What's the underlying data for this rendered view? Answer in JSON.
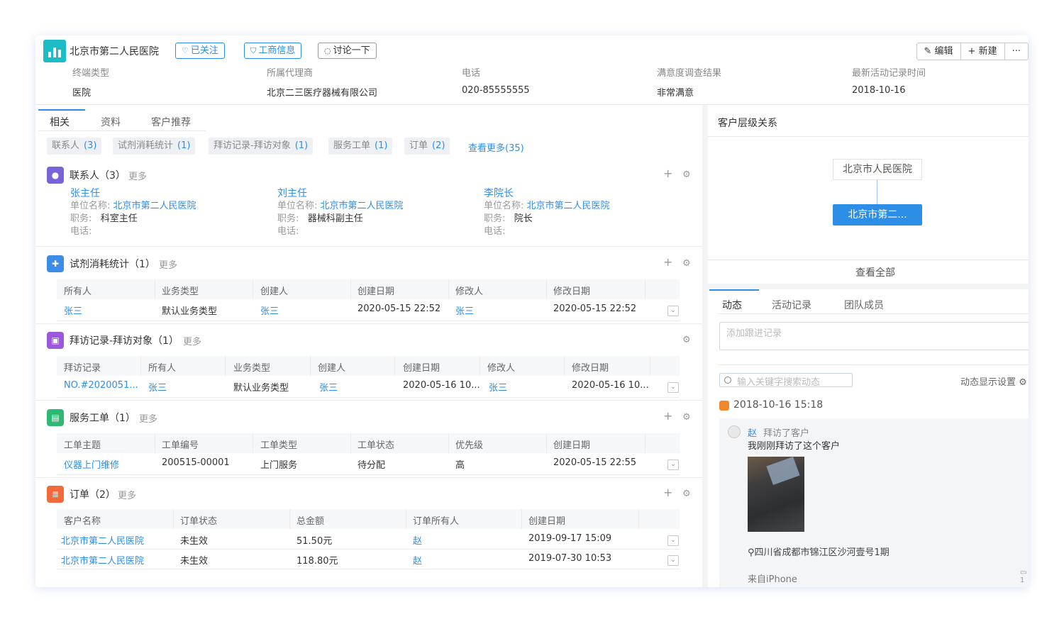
{
  "header": {
    "name": "北京市第二人民医院",
    "tags": {
      "follow": "已关注",
      "biz": "工商信息",
      "discuss": "讨论一下"
    },
    "actions": {
      "edit": "编辑",
      "new": "新建",
      "more": "···"
    },
    "fields": [
      {
        "k": "终端类型",
        "v": "医院"
      },
      {
        "k": "所属代理商",
        "v": "北京二三医疗器械有限公司"
      },
      {
        "k": "电话",
        "v": "020-85555555"
      },
      {
        "k": "满意度调查结果",
        "v": "非常满意"
      },
      {
        "k": "最新活动记录时间",
        "v": "2018-10-16"
      }
    ]
  },
  "tabs": [
    "相关",
    "资料",
    "客户推荐"
  ],
  "chips": [
    {
      "label": "联系人",
      "count": "(3)"
    },
    {
      "label": "试剂消耗统计",
      "count": "(1)"
    },
    {
      "label": "拜访记录-拜访对象",
      "count": "(1)"
    },
    {
      "label": "服务工单",
      "count": "(1)"
    },
    {
      "label": "订单",
      "count": "(2)"
    }
  ],
  "more35": "查看更多(35)",
  "common": {
    "more": "更多",
    "plus": "+",
    "gear": "⚙",
    "chev": "⌄"
  },
  "contacts": {
    "title": "联系人（3）",
    "labels": {
      "unit": "单位名称:",
      "job": "职务:",
      "phone": "电话:"
    },
    "items": [
      {
        "name": "张主任",
        "unit": "北京市第二人民医院",
        "job": "科室主任"
      },
      {
        "name": "刘主任",
        "unit": "北京市第二人民医院",
        "job": "器械科副主任"
      },
      {
        "name": "李院长",
        "unit": "北京市第二人民医院",
        "job": "院长"
      }
    ]
  },
  "reagent": {
    "title": "试剂消耗统计（1）",
    "cols": [
      "所有人",
      "业务类型",
      "创建人",
      "创建日期",
      "修改人",
      "修改日期"
    ],
    "row": [
      "张三",
      "默认业务类型",
      "张三",
      "2020-05-15 22:52",
      "张三",
      "2020-05-15 22:52"
    ]
  },
  "visit": {
    "title": "拜访记录-拜访对象（1）",
    "cols": [
      "拜访记录",
      "所有人",
      "业务类型",
      "创建人",
      "创建日期",
      "修改人",
      "修改日期"
    ],
    "row": [
      "NO.#2020051...",
      "张三",
      "默认业务类型",
      "张三",
      "2020-05-16 10...",
      "张三",
      "2020-05-16 10..."
    ]
  },
  "service": {
    "title": "服务工单（1）",
    "cols": [
      "工单主题",
      "工单编号",
      "工单类型",
      "工单状态",
      "优先级",
      "创建日期"
    ],
    "row": [
      "仪器上门维修",
      "200515-00001",
      "上门服务",
      "待分配",
      "高",
      "2020-05-15 22:55"
    ]
  },
  "orders": {
    "title": "订单（2）",
    "cols": [
      "客户名称",
      "订单状态",
      "总金额",
      "订单所有人",
      "创建日期"
    ],
    "rows": [
      [
        "北京市第二人民医院",
        "未生效",
        "51.50元",
        "赵",
        "2019-09-17 15:09"
      ],
      [
        "北京市第二人民医院",
        "未生效",
        "118.80元",
        "赵",
        "2019-07-30 10:53"
      ]
    ]
  },
  "hierarchy": {
    "title": "客户层级关系",
    "parent": "北京市人民医院",
    "current": "北京市第二...",
    "view_all": "查看全部"
  },
  "dynamics": {
    "tabs": [
      "动态",
      "活动记录",
      "团队成员"
    ],
    "follow_placeholder": "添加跟进记录",
    "search_placeholder": "输入关键字搜索动态",
    "settings": "动态显示设置",
    "date": "2018-10-16 15:18",
    "post": {
      "user": "赵",
      "action": "拜访了客户",
      "message": "我刚刚拜访了这个客户",
      "location": "四川省成都市锦江区沙河壹号1期",
      "from": "来自iPhone",
      "comments": "1"
    }
  }
}
